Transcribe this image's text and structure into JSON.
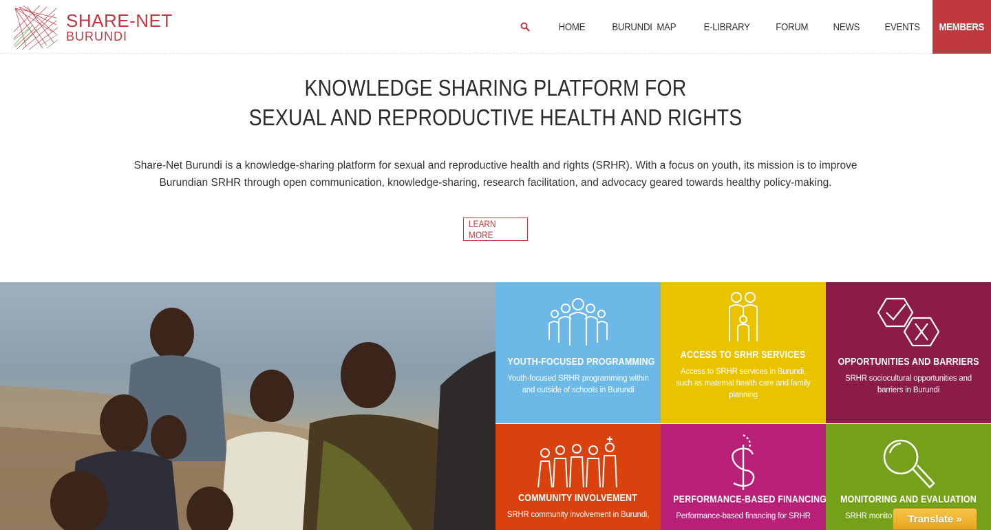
{
  "brand": {
    "name_line1": "SHARE-NET",
    "name_line2": "BURUNDI",
    "color": "#c0393f"
  },
  "nav": {
    "search_icon": "search-icon",
    "items": [
      {
        "label": "HOME"
      },
      {
        "label": "BURUNDI  MAP"
      },
      {
        "label": "E-LIBRARY"
      },
      {
        "label": "FORUM"
      },
      {
        "label": "NEWS"
      },
      {
        "label": "EVENTS"
      }
    ],
    "members_label": "MEMBERS"
  },
  "hero": {
    "title_line1": "KNOWLEDGE SHARING PLATFORM FOR",
    "title_line2": "SEXUAL AND REPRODUCTIVE HEALTH AND RIGHTS",
    "description": "Share-Net Burundi is a knowledge-sharing platform for sexual and reproductive health and rights (SRHR). With a focus on youth, its mission is to improve Burundian SRHR through open communication, knowledge-sharing, research facilitation, and advocacy geared towards healthy policy-making.",
    "cta_label": "LEARN MORE"
  },
  "tiles": [
    {
      "title": "YOUTH-FOCUSED PROGRAMMING",
      "desc": "Youth-focused SRHR programming within and outside of schools in Burundi",
      "color": "#6cb8e6",
      "icon": "youth-group-icon"
    },
    {
      "title": "ACCESS TO SRHR SERVICES",
      "desc": "Access to SRHR services in Burundi, such as maternal health care and family planning",
      "color": "#e9c200",
      "icon": "family-icon"
    },
    {
      "title": "OPPORTUNITIES AND BARRIERS",
      "desc": "SRHR sociocultural opportunities and barriers in Burundi",
      "color": "#8a1c47",
      "icon": "check-cross-icon"
    },
    {
      "title": "COMMUNITY INVOLVEMENT",
      "desc": "SRHR community involvement in Burundi,",
      "color": "#d9410e",
      "icon": "community-icon"
    },
    {
      "title": "PERFORMANCE-BASED FINANCING",
      "desc": "Performance-based financing for SRHR",
      "color": "#b81f77",
      "icon": "dollar-icon"
    },
    {
      "title": "MONITORING AND EVALUATION",
      "desc": "SRHR monito",
      "color": "#75a11a",
      "icon": "magnifier-icon"
    }
  ],
  "translate_label": "Translate »"
}
